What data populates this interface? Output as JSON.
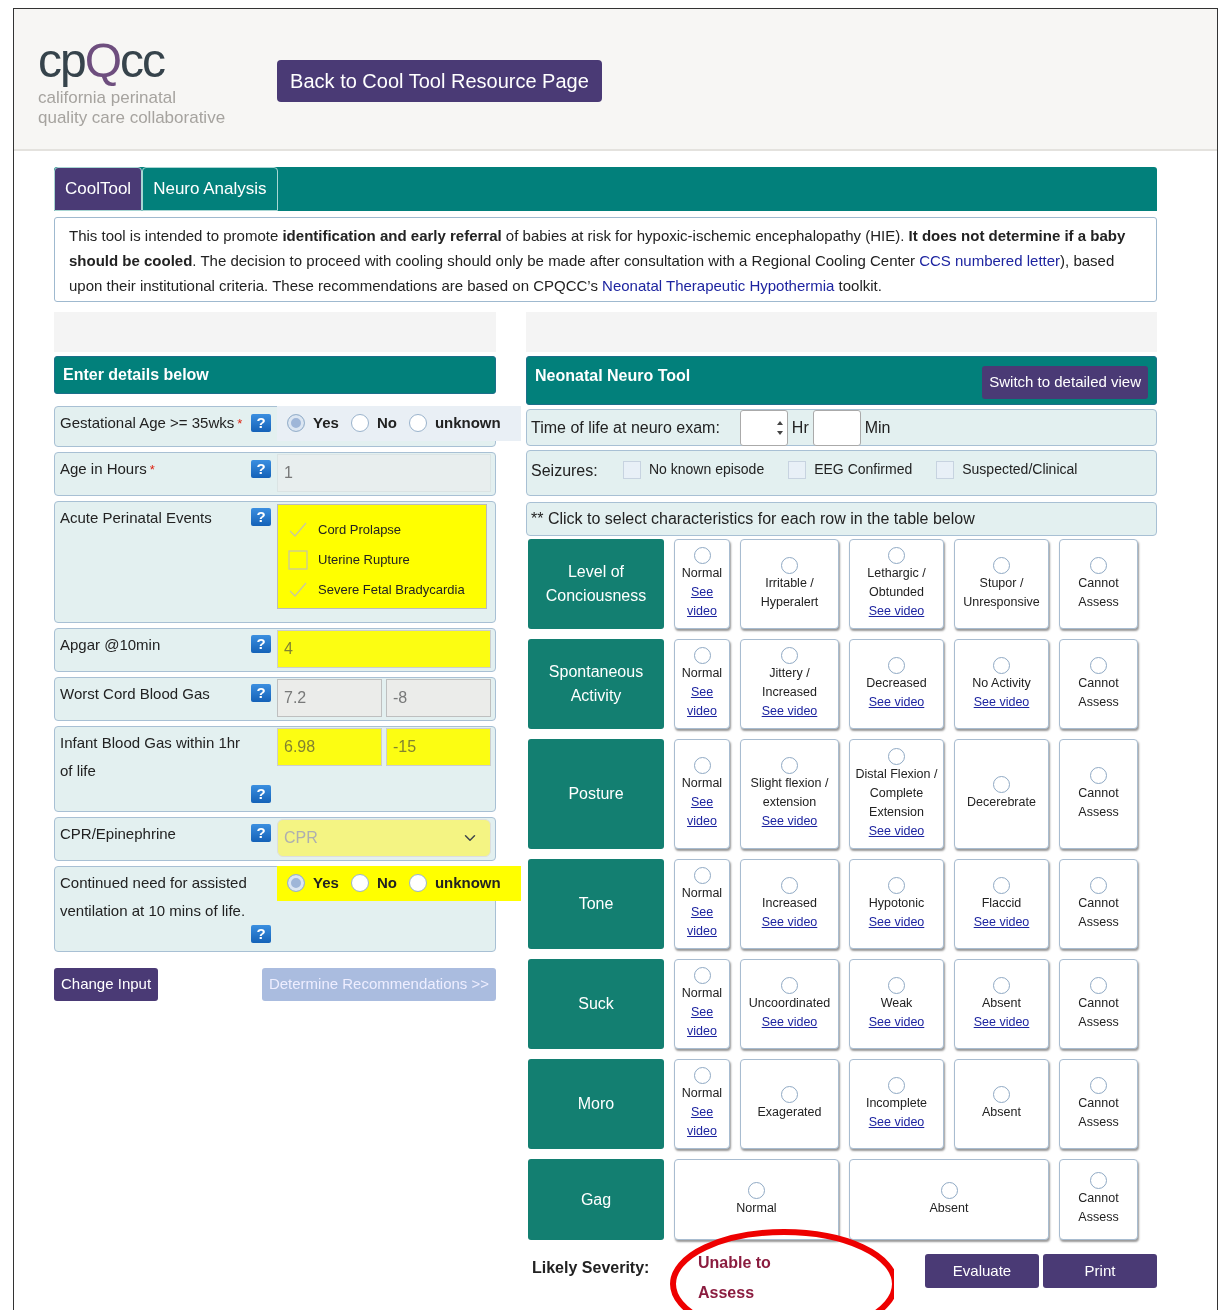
{
  "header": {
    "logo": {
      "parts": [
        {
          "text": "cp",
          "accent": false
        },
        {
          "text": "Q",
          "accent": true
        },
        {
          "text": "cc",
          "accent": false
        }
      ],
      "tagline": [
        "california perinatal",
        "quality care collaborative"
      ]
    },
    "back_button": "Back to Cool Tool Resource Page"
  },
  "tabs": [
    {
      "label": "CoolTool",
      "selected": true
    },
    {
      "label": "Neuro Analysis",
      "selected": false
    }
  ],
  "intro": [
    {
      "kind": "text",
      "text": "This tool is intended to promote **identification and early referral** of babies at risk for hypoxic-ischemic encephalopathy (HIE). **It does not determine if a baby should be cooled**. The decision to proceed with cooling should only be made after consultation with a Regional Cooling Center "
    },
    {
      "kind": "link",
      "text": "CCS numbered letter"
    },
    {
      "kind": "text",
      "text": "), based upon their institutional criteria. These recommendations are based on CPQCC’s "
    },
    {
      "kind": "link",
      "text": "Neonatal Therapeutic Hypothermia"
    },
    {
      "kind": "text",
      "text": " toolkit."
    }
  ],
  "details": {
    "title": "Enter details below",
    "rows": [
      {
        "kind": "radio",
        "label": "Gestational Age >= 35wks",
        "required_mark": "*",
        "help": "?",
        "highlighted": false,
        "options": [
          {
            "label": "Yes",
            "selected": true
          },
          {
            "label": "No",
            "selected": false
          },
          {
            "label": "unknown",
            "selected": false
          }
        ]
      },
      {
        "kind": "input",
        "label": "Age in Hours",
        "required_mark": "*",
        "help": "?",
        "fields": [
          {
            "value": "1",
            "highlighted": false,
            "disabled": true
          }
        ]
      },
      {
        "kind": "checklist",
        "label": "Acute Perinatal Events",
        "help": "?",
        "highlighted": true,
        "items": [
          {
            "label": "Cord Prolapse",
            "checked": true
          },
          {
            "label": "Uterine Rupture",
            "checked": false
          },
          {
            "label": "Severe Fetal Bradycardia",
            "checked": true
          }
        ]
      },
      {
        "kind": "input",
        "label": "Apgar @10min",
        "help": "?",
        "fields": [
          {
            "value": "4",
            "highlighted": true,
            "disabled": true
          }
        ]
      },
      {
        "kind": "input",
        "label": "Worst Cord Blood Gas",
        "help": "?",
        "fields": [
          {
            "value": "7.2",
            "highlighted": false,
            "disabled": true
          },
          {
            "value": "-8",
            "highlighted": false,
            "disabled": true
          }
        ]
      },
      {
        "kind": "input",
        "label": "Infant Blood Gas within 1hr of life",
        "help": "?",
        "fields": [
          {
            "value": "6.98",
            "highlighted": true,
            "disabled": true
          },
          {
            "value": "-15",
            "highlighted": true,
            "disabled": true
          }
        ]
      },
      {
        "kind": "select",
        "label": "CPR/Epinephrine",
        "help": "?",
        "fields": [
          {
            "value": "CPR",
            "highlighted": true,
            "disabled": true
          }
        ]
      },
      {
        "kind": "radio",
        "label": "Continued need for assisted ventilation at 10 mins of life.",
        "help": "?",
        "highlighted": true,
        "options": [
          {
            "label": "Yes",
            "selected": true
          },
          {
            "label": "No",
            "selected": false
          },
          {
            "label": "unknown",
            "selected": false
          }
        ]
      }
    ],
    "buttons": [
      {
        "label": "Change Input",
        "disabled": false
      },
      {
        "label": "Determine Recommendations >>",
        "disabled": true
      }
    ]
  },
  "neuro": {
    "title": "Neonatal Neuro Tool",
    "switch_button": "Switch to detailed view",
    "time": {
      "label": "Time of life at neuro exam:",
      "hours_unit": "Hr",
      "minutes_unit": "Min"
    },
    "seizures": {
      "label": "Seizures:",
      "options": [
        {
          "label": "No known episode",
          "checked": false
        },
        {
          "label": "EEG Confirmed",
          "checked": false
        },
        {
          "label": "Suspected/Clinical",
          "checked": false
        }
      ]
    },
    "note": "** Click to select characteristics for each row in the table below",
    "rows": [
      {
        "label": "Level of Conciousness",
        "options": [
          {
            "label": "Normal",
            "video": "See video",
            "selected": false
          },
          {
            "label": "Irritable / Hyperalert",
            "selected": false
          },
          {
            "label": "Lethargic / Obtunded",
            "video": "See video",
            "selected": false
          },
          {
            "label": "Stupor / Unresponsive",
            "selected": false
          },
          {
            "label": "Cannot Assess",
            "selected": false
          }
        ]
      },
      {
        "label": "Spontaneous Activity",
        "options": [
          {
            "label": "Normal",
            "video": "See video",
            "selected": false
          },
          {
            "label": "Jittery / Increased",
            "video": "See video",
            "selected": false
          },
          {
            "label": "Decreased",
            "video": "See video",
            "selected": false
          },
          {
            "label": "No Activity",
            "video": "See video",
            "selected": false
          },
          {
            "label": "Cannot Assess",
            "selected": false
          }
        ]
      },
      {
        "label": "Posture",
        "options": [
          {
            "label": "Normal",
            "video": "See video",
            "selected": false
          },
          {
            "label": "Slight flexion / extension",
            "video": "See video",
            "selected": false
          },
          {
            "label": "Distal Flexion / Complete Extension",
            "video": "See video",
            "selected": false
          },
          {
            "label": "Decerebrate",
            "selected": false
          },
          {
            "label": "Cannot Assess",
            "selected": false
          }
        ]
      },
      {
        "label": "Tone",
        "options": [
          {
            "label": "Normal",
            "video": "See video",
            "selected": false
          },
          {
            "label": "Increased",
            "video": "See video",
            "selected": false
          },
          {
            "label": "Hypotonic",
            "video": "See video",
            "selected": false
          },
          {
            "label": "Flaccid",
            "video": "See video",
            "selected": false
          },
          {
            "label": "Cannot Assess",
            "selected": false
          }
        ]
      },
      {
        "label": "Suck",
        "options": [
          {
            "label": "Normal",
            "video": "See video",
            "selected": false
          },
          {
            "label": "Uncoordinated",
            "video": "See video",
            "selected": false
          },
          {
            "label": "Weak",
            "video": "See video",
            "selected": false
          },
          {
            "label": "Absent",
            "video": "See video",
            "selected": false
          },
          {
            "label": "Cannot Assess",
            "selected": false
          }
        ]
      },
      {
        "label": "Moro",
        "options": [
          {
            "label": "Normal",
            "video": "See video",
            "selected": false
          },
          {
            "label": "Exagerated",
            "selected": false
          },
          {
            "label": "Incomplete",
            "video": "See video",
            "selected": false
          },
          {
            "label": "Absent",
            "selected": false
          },
          {
            "label": "Cannot Assess",
            "selected": false
          }
        ]
      },
      {
        "label": "Gag",
        "options": [
          {
            "label": "Normal",
            "wide": true,
            "selected": false
          },
          {
            "label": "Absent",
            "wide": true,
            "selected": false
          },
          {
            "label": "Cannot Assess",
            "selected": false
          }
        ]
      }
    ],
    "severity": {
      "label": "Likely Severity:",
      "value": "Unable to Assess"
    },
    "buttons": [
      "Evaluate",
      "Print"
    ]
  }
}
